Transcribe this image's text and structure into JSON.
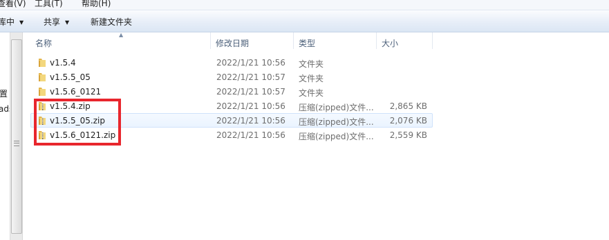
{
  "menubar": {
    "view": "查看(V)",
    "tools": "工具(T)",
    "help": "帮助(H)"
  },
  "toolbar": {
    "include_library": "库中",
    "share": "共享",
    "new_folder": "新建文件夹"
  },
  "nav": {
    "item1": "置",
    "item2": "ads"
  },
  "columns": {
    "name": "名称",
    "modified": "修改日期",
    "type": "类型",
    "size": "大小"
  },
  "files": [
    {
      "name": "v1.5.4",
      "modified": "2022/1/21 10:56",
      "type": "文件夹",
      "size": "",
      "kind": "folder-icon"
    },
    {
      "name": "v1.5.5_05",
      "modified": "2022/1/21 10:57",
      "type": "文件夹",
      "size": "",
      "kind": "folder-icon"
    },
    {
      "name": "v1.5.6_0121",
      "modified": "2022/1/21 10:57",
      "type": "文件夹",
      "size": "",
      "kind": "folder-icon"
    },
    {
      "name": "v1.5.4.zip",
      "modified": "2022/1/21 10:56",
      "type": "压缩(zipped)文件...",
      "size": "2,865 KB",
      "kind": "zip-folder-icon"
    },
    {
      "name": "v1.5.5_05.zip",
      "modified": "2022/1/21 10:56",
      "type": "压缩(zipped)文件...",
      "size": "2,076 KB",
      "kind": "zip-folder-icon"
    },
    {
      "name": "v1.5.6_0121.zip",
      "modified": "2022/1/21 10:56",
      "type": "压缩(zipped)文件...",
      "size": "2,559 KB",
      "kind": "zip-folder-icon"
    }
  ],
  "colors": {
    "highlight": "#e8262d",
    "folder": "#e9c35a",
    "header_text": "#4c607a"
  }
}
